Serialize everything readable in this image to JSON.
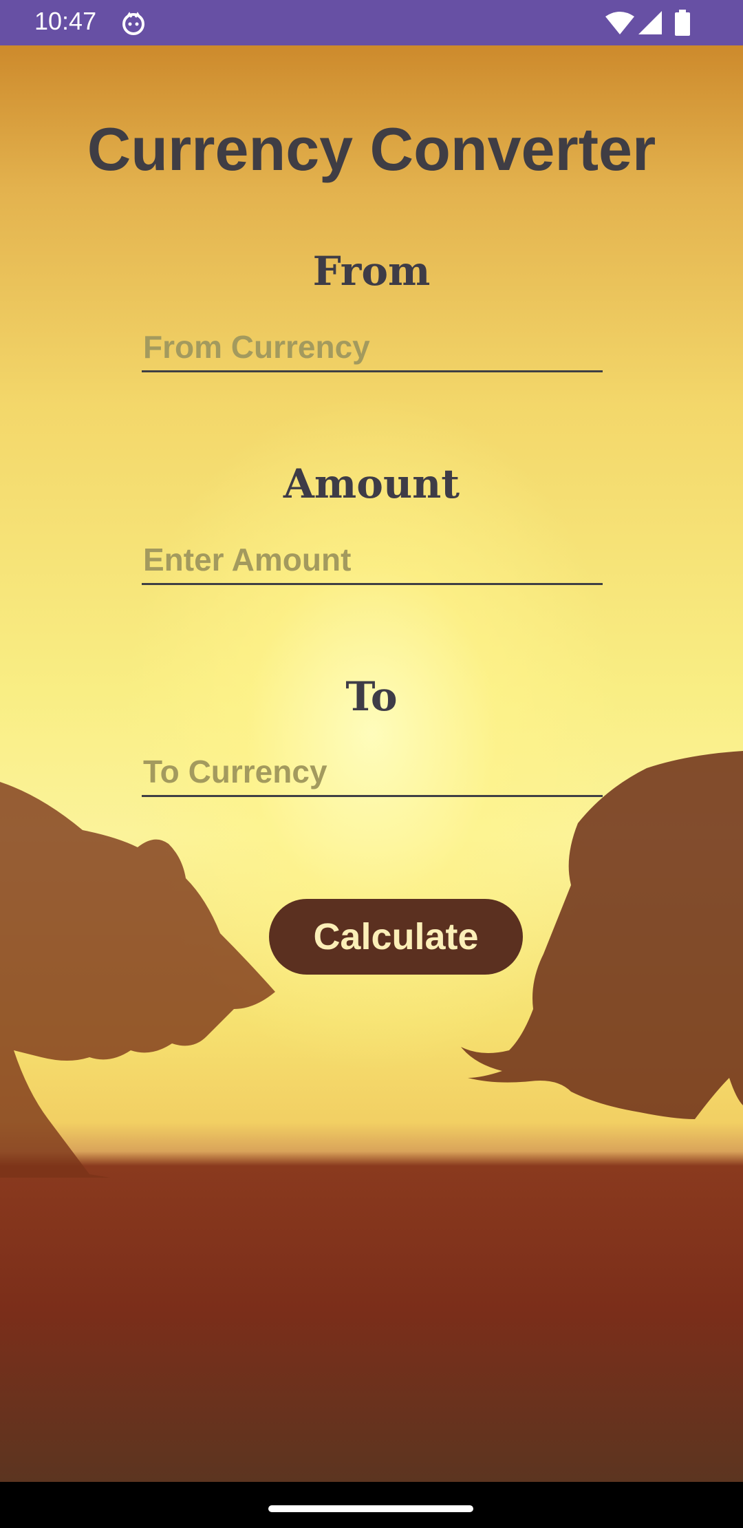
{
  "status_bar": {
    "time": "10:47",
    "icons": [
      "app-notification-icon",
      "wifi-icon",
      "signal-icon",
      "battery-icon"
    ],
    "background": "#6750a4"
  },
  "app": {
    "title": "Currency Converter",
    "from": {
      "heading": "From",
      "placeholder": "From Currency",
      "value": ""
    },
    "amount": {
      "heading": "Amount",
      "placeholder": "Enter Amount",
      "value": ""
    },
    "to": {
      "heading": "To",
      "placeholder": "To Currency",
      "value": ""
    },
    "calculate_label": "Calculate",
    "background_image": "bull-and-bear-silhouettes-at-sunset",
    "colors": {
      "button": "#5b3020",
      "button_text": "#fbefb8",
      "title_text": "#3f3d44",
      "placeholder": "#a39a5e"
    }
  },
  "nav_bar": {
    "handle": "home-gesture-handle"
  }
}
